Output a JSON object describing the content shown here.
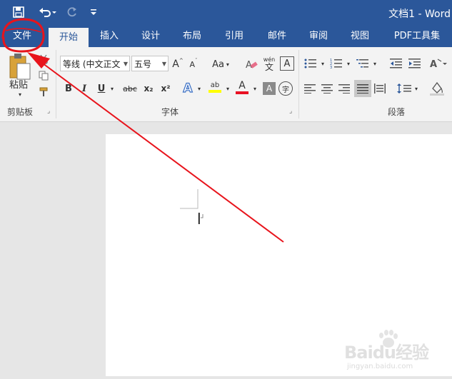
{
  "window": {
    "title": "文档1 - Word"
  },
  "quick_access": {
    "save_icon": "save-icon",
    "undo_icon": "undo-icon",
    "redo_icon": "redo-icon",
    "customize_icon": "customize-qat-icon"
  },
  "tabs": [
    {
      "label": "文件"
    },
    {
      "label": "开始"
    },
    {
      "label": "插入"
    },
    {
      "label": "设计"
    },
    {
      "label": "布局"
    },
    {
      "label": "引用"
    },
    {
      "label": "邮件"
    },
    {
      "label": "审阅"
    },
    {
      "label": "视图"
    },
    {
      "label": "PDF工具集"
    }
  ],
  "clipboard": {
    "paste_label": "粘贴",
    "group_label": "剪贴板"
  },
  "font": {
    "font_name": "等线 (中文正文",
    "font_size": "五号",
    "grow_label": "A",
    "shrink_label": "A",
    "case_label": "Aa",
    "bold": "B",
    "italic": "I",
    "underline": "U",
    "strike": "abc",
    "subscript": "x₂",
    "superscript": "x²",
    "text_effects": "A",
    "highlight": "ab",
    "font_color": "A",
    "char_shading": "A",
    "phonetic_top": "wén",
    "phonetic_bottom": "文",
    "char_border": "A",
    "enclose": "字",
    "group_label": "字体"
  },
  "paragraph": {
    "group_label": "段落"
  },
  "styles": {
    "effect_label": "A"
  },
  "colors": {
    "accent": "#2b579a",
    "annotation": "#e8141c",
    "font_color_bar": "#e81123",
    "highlight_bar": "#ffff00"
  },
  "watermark": {
    "brand": "Baidu经验",
    "url": "jingyan.baidu.com"
  }
}
